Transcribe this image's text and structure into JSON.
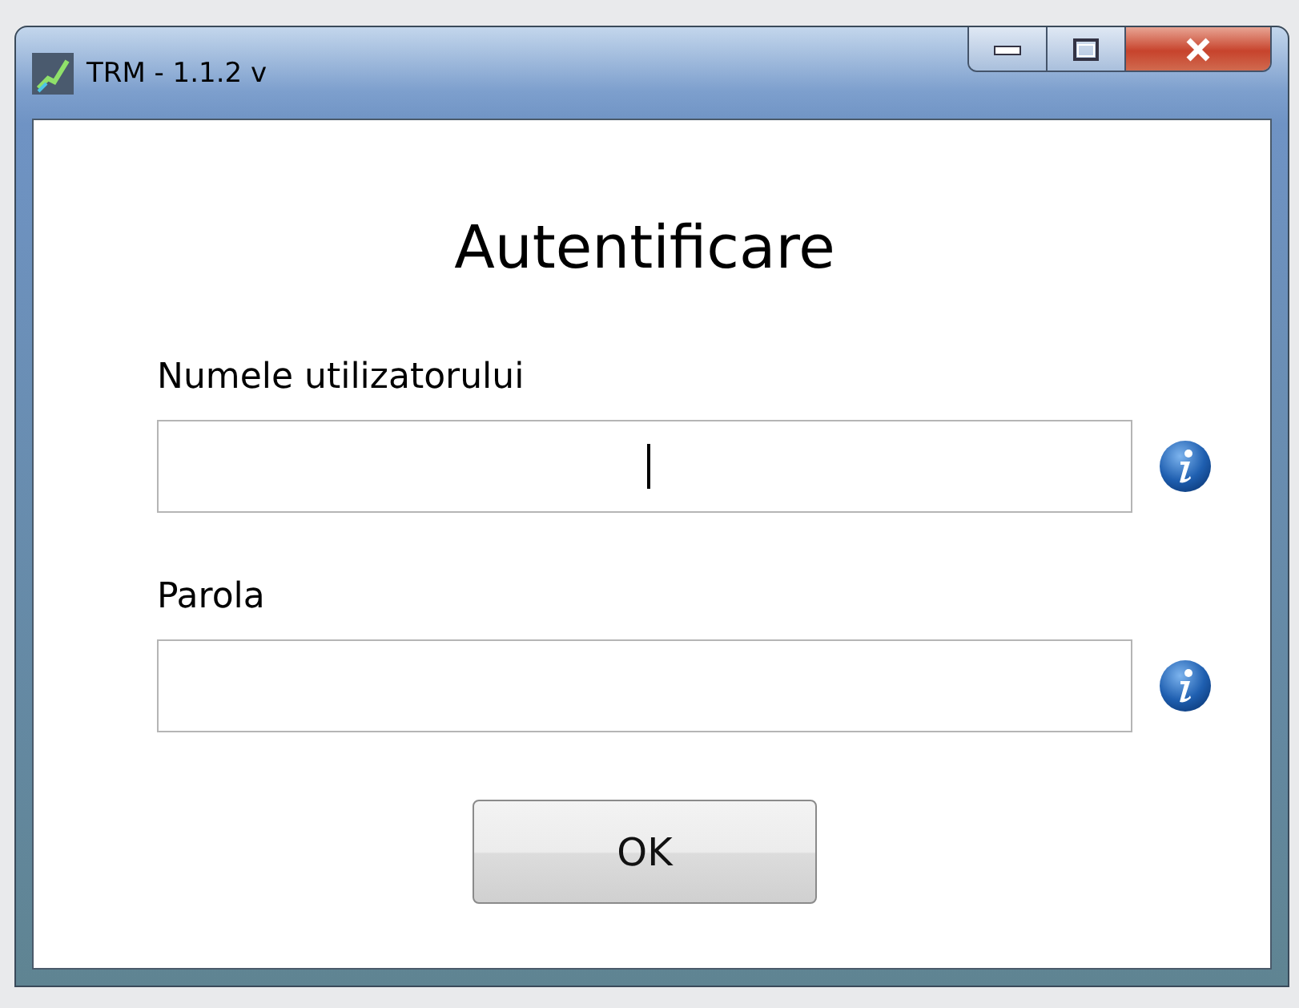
{
  "window": {
    "title": "TRM - 1.1.2 v"
  },
  "heading": "Autentificare",
  "fields": [
    {
      "label": "Numele utilizatorului",
      "focused": true
    },
    {
      "label": "Parola",
      "focused": false
    }
  ],
  "buttons": [
    "OK"
  ]
}
